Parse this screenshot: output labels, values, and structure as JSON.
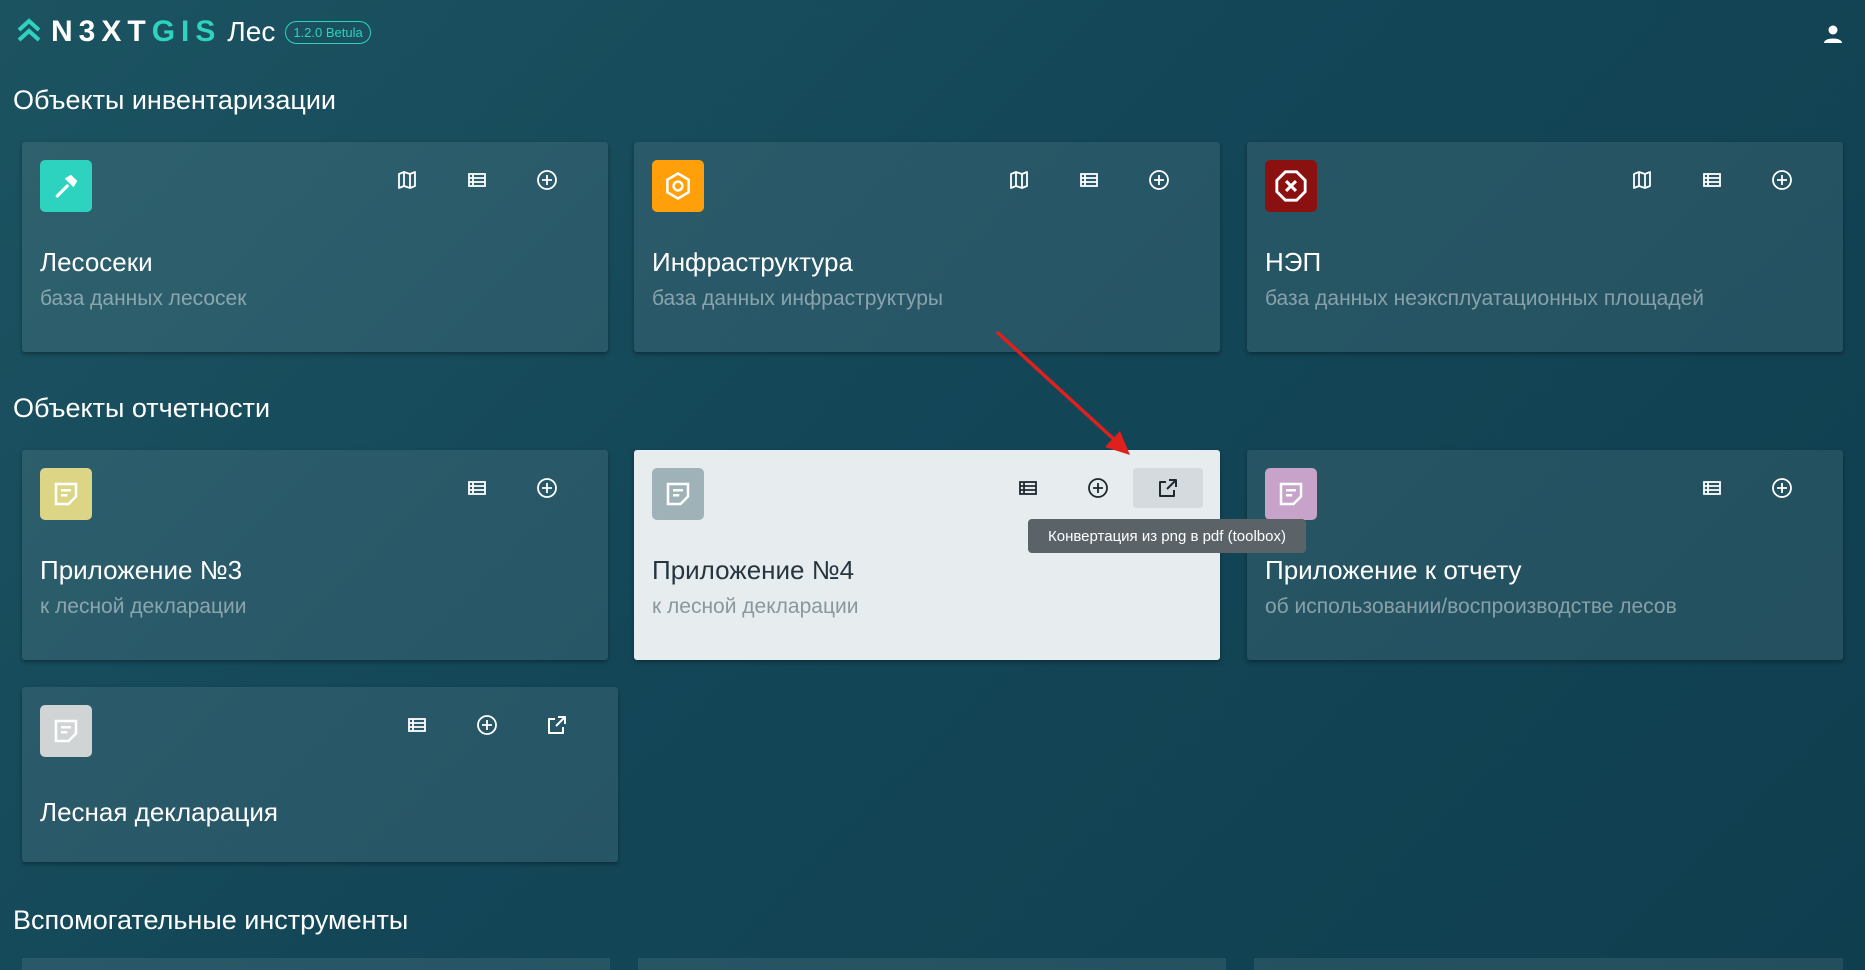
{
  "header": {
    "logo_text_a": "N3XT",
    "logo_text_b": "GIS",
    "app_name": "Лес",
    "version": "1.2.0 Betula"
  },
  "sections": {
    "inventory": "Объекты инвентаризации",
    "reporting": "Объекты отчетности",
    "tools": "Вспомогательные инструменты"
  },
  "cards": {
    "cutting": {
      "title": "Лесосеки",
      "subtitle": "база данных лесосек",
      "icon": "hammer-icon",
      "color": "#2ed3bf"
    },
    "infra": {
      "title": "Инфраструктура",
      "subtitle": "база данных инфраструктуры",
      "icon": "gear-icon",
      "color": "#ff9f0a"
    },
    "nep": {
      "title": "НЭП",
      "subtitle": "база данных неэксплуатационных площадей",
      "icon": "close-octagon-icon",
      "color": "#8b1010"
    },
    "app3": {
      "title": "Приложение №3",
      "subtitle": "к лесной декларации",
      "icon": "note-icon",
      "color": "#dcd585"
    },
    "app4": {
      "title": "Приложение №4",
      "subtitle": "к лесной декларации",
      "icon": "note-icon",
      "color": "#9fb2b8"
    },
    "report": {
      "title": "Приложение к отчету",
      "subtitle": "об использовании/воспроизводстве лесов",
      "icon": "note-icon",
      "color": "#c7a2c9"
    },
    "decl": {
      "title": "Лесная декларация",
      "subtitle": "",
      "icon": "note-icon",
      "color": "#d1d4d5"
    }
  },
  "tooltip": "Конвертация из png в pdf (toolbox)",
  "colors": {
    "accent": "#2ed3bf",
    "arrow": "#e0201c"
  }
}
